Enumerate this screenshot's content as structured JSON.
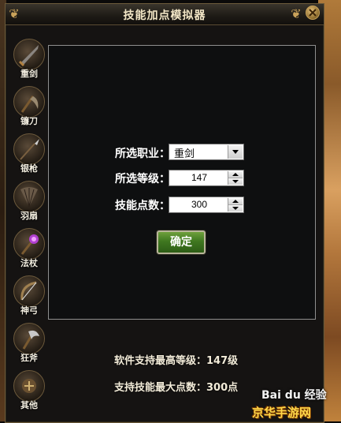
{
  "window": {
    "title": "技能加点模拟器"
  },
  "sidebar": {
    "items": [
      {
        "label": "重剑",
        "icon": "greatsword-icon"
      },
      {
        "label": "镰刀",
        "icon": "scythe-icon"
      },
      {
        "label": "银枪",
        "icon": "spear-icon"
      },
      {
        "label": "羽扇",
        "icon": "feather-fan-icon"
      },
      {
        "label": "法杖",
        "icon": "staff-icon"
      },
      {
        "label": "神弓",
        "icon": "bow-icon"
      },
      {
        "label": "狂斧",
        "icon": "axe-icon"
      },
      {
        "label": "其他",
        "icon": "other-icon"
      }
    ]
  },
  "form": {
    "class_label": "所选职业：",
    "class_value": "重剑",
    "level_label": "所选等级：",
    "level_value": "147",
    "points_label": "技能点数：",
    "points_value": "300",
    "confirm_label": "确定"
  },
  "info": {
    "max_level": "软件支持最高等级：147级",
    "max_points": "支持技能最大点数：300点"
  },
  "watermark": {
    "baidu": "Bai du 经验",
    "site": "京华手游网"
  },
  "colors": {
    "accent_green": "#3f7820",
    "title_text": "#f2e6c6",
    "frame_gold": "#c9a25a"
  }
}
